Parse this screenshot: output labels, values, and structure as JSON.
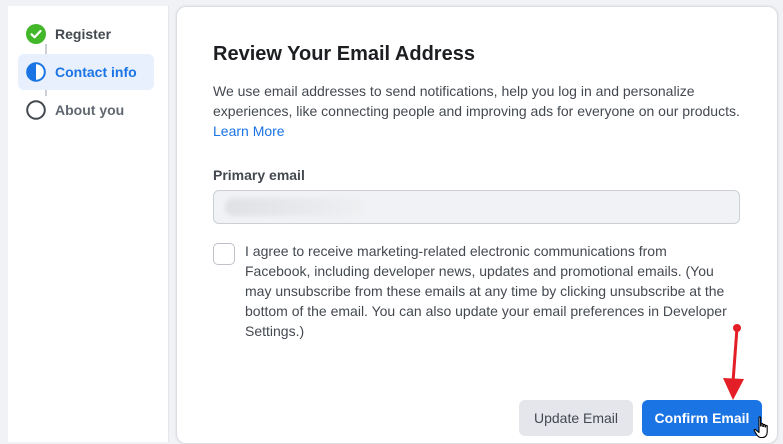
{
  "stepper": {
    "steps": [
      {
        "label": "Register",
        "state": "complete",
        "icon": "check-circle-icon"
      },
      {
        "label": "Contact info",
        "state": "current",
        "icon": "half-circle-icon"
      },
      {
        "label": "About you",
        "state": "upcoming",
        "icon": "empty-circle-icon"
      }
    ]
  },
  "main": {
    "title": "Review Your Email Address",
    "description": "We use email addresses to send notifications, help you log in and personalize experiences, like connecting people and improving ads for everyone on our products.",
    "learn_more": "Learn More",
    "email_label": "Primary email",
    "email_value": "",
    "consent_text": "I agree to receive marketing-related electronic communications from Facebook, including developer news, updates and promotional emails. (You may unsubscribe from these emails at any time by clicking unsubscribe at the bottom of the email. You can also update your email preferences in Developer Settings.)",
    "consent_checked": false
  },
  "actions": {
    "update_label": "Update Email",
    "confirm_label": "Confirm Email"
  },
  "colors": {
    "accent": "#1b74e4",
    "complete": "#42b72a",
    "annotation_arrow": "#e41e26"
  }
}
